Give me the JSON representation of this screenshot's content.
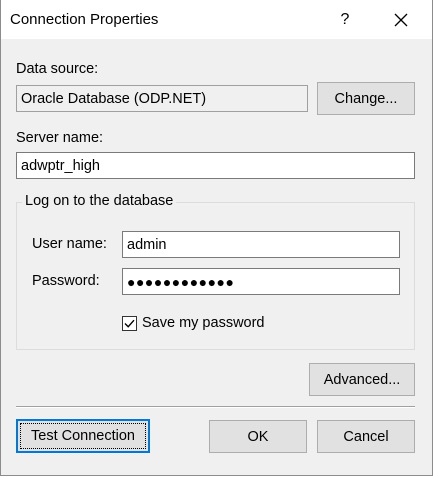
{
  "window": {
    "title": "Connection Properties",
    "help_label": "?",
    "close_icon": "close-icon"
  },
  "data_source": {
    "label": "Data source:",
    "value": "Oracle Database (ODP.NET)",
    "change_button": "Change..."
  },
  "server": {
    "label": "Server name:",
    "value": "adwptr_high"
  },
  "logon": {
    "group_label": "Log on to the database",
    "username_label": "User name:",
    "username_value": "admin",
    "password_label": "Password:",
    "password_value": "●●●●●●●●●●●●",
    "save_password_label": "Save my password",
    "save_password_checked": true
  },
  "buttons": {
    "advanced": "Advanced...",
    "test_connection": "Test Connection",
    "ok": "OK",
    "cancel": "Cancel"
  },
  "colors": {
    "dialog_bg": "#f0f0f0",
    "titlebar_bg": "#ffffff",
    "button_bg": "#e1e1e1",
    "default_button_border": "#0078d7"
  }
}
